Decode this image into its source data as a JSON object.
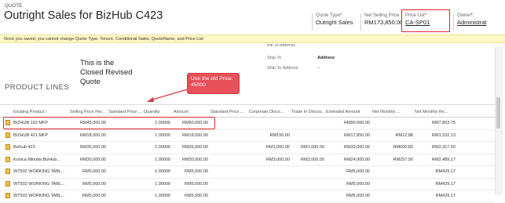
{
  "header": {
    "kicker": "QUOTE",
    "title": "Outright Sales for BizHub C423",
    "fields": {
      "quote_type": {
        "label": "Quote Type",
        "value": "Outright Sales"
      },
      "net_selling_price": {
        "label": "Net Selling Price",
        "value": "RM173,850.00"
      },
      "price_list": {
        "label": "Price List",
        "value": "CA-SP01"
      },
      "owner": {
        "label": "Owner",
        "value": "Administrat"
      }
    },
    "required_mark": "*"
  },
  "warning_text": "Once you saved, you cannot change Quote Type, Tenure, Conditional Sales, QuoteName, and Price List",
  "annotation": {
    "note_lines": [
      "This is the",
      "Closed Revised",
      "Quote"
    ],
    "callout_lines": [
      "Use the old Price:",
      "45000"
    ]
  },
  "address": {
    "truncated_label": "Bill To Address",
    "ship_to_label": "Ship To",
    "ship_to_value": "Address",
    "ship_to_address_label": "Ship To Address",
    "ship_to_address_value": "--"
  },
  "section_title": "PRODUCT LINES",
  "columns": [
    "Existing Product ↑",
    "Selling Price Per...",
    "Standard Price ...",
    "Quantity",
    "Amount",
    "Standard Price ...",
    "Corporate Disco...",
    "Trade In Discou...",
    "Extended Amount",
    "Net Monthly ...",
    "Net Monthly Re..."
  ],
  "rows": [
    [
      "BIZHUB 162 MFP",
      "RM45,000.00",
      "",
      "2.00000",
      "RM90,000.00",
      "",
      "",
      "",
      "RM90,000.00",
      "",
      "RM7,853.75"
    ],
    [
      "BIZHUB 421 MFP",
      "RM18,000.00",
      "",
      "1.00000",
      "RM18,000.00",
      "",
      "RM150.00",
      "",
      "RM17,850.00",
      "RM12.88",
      "RM1,532.13"
    ],
    [
      "Bizhub 423",
      "RM35,000.00",
      "",
      "1.00000",
      "RM35,000.00",
      "",
      "RM1,000.00",
      "RM1,000.00",
      "RM33,000.00",
      "RM600.83",
      "RM2,317.50"
    ],
    [
      "Konica Minolta BizHub...",
      "RM30,000.00",
      "",
      "1.00000",
      "RM30,000.00",
      "",
      "RM3,000.00",
      "RM3,000.00",
      "RM24,000.00",
      "RM257.50",
      "RM2,489.17"
    ],
    [
      "WT502 WORKING TABL...",
      "RM5,000.00",
      "",
      "1.00000",
      "RM5,000.00",
      "",
      "",
      "",
      "RM5,000.00",
      "",
      "RM429.17"
    ],
    [
      "WT502 WORKING TABL...",
      "RM5,000.00",
      "",
      "1.00000",
      "RM5,000.00",
      "",
      "",
      "",
      "RM5,000.00",
      "",
      "RM429.17"
    ],
    [
      "WT502 WORKING TABL...",
      "RM5,000.00",
      "",
      "1.00000",
      "RM5,000.00",
      "",
      "",
      "",
      "RM5,000.00",
      "",
      "RM429.17"
    ]
  ],
  "colors": {
    "highlight_border": "#e0282e",
    "callout_fill": "#e8505a",
    "warning_bg": "#fff8c4",
    "link": "#1d5da8"
  },
  "icons": {
    "product_row": "document-icon",
    "sort": "sort-up-arrow"
  }
}
